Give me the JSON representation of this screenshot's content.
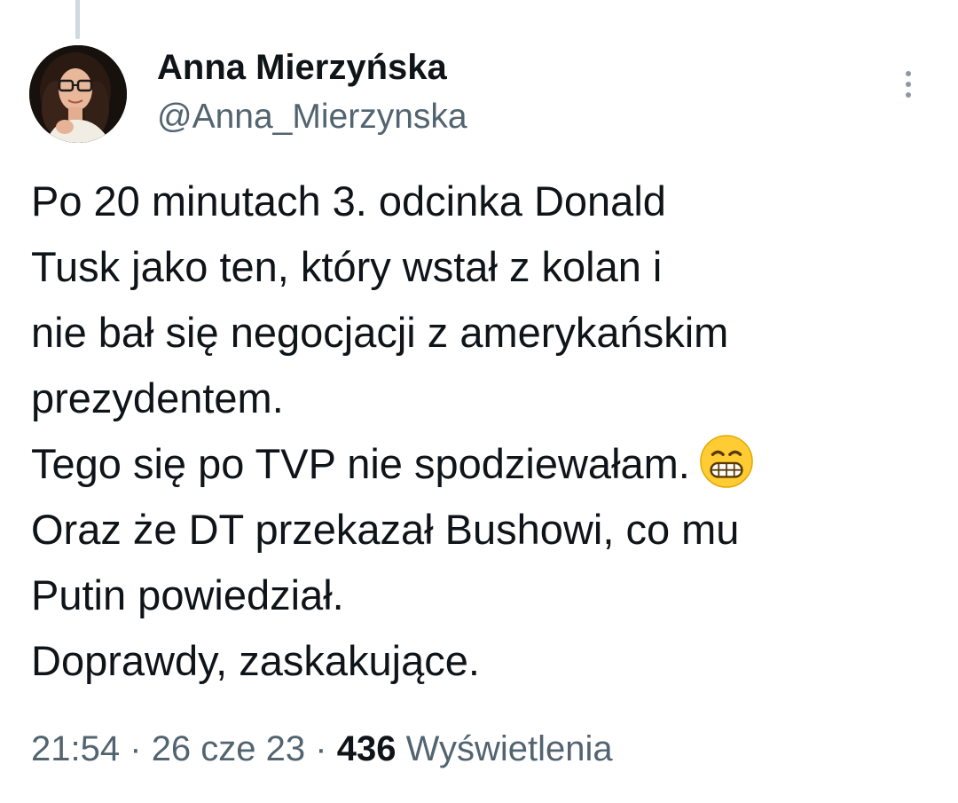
{
  "tweet": {
    "author": {
      "display_name": "Anna Mierzyńska",
      "handle": "@Anna_Mierzynska"
    },
    "text_lines": [
      "Po 20 minutach 3. odcinka Donald",
      "Tusk jako ten, który wstał z kolan i",
      "nie bał się negocjacji z amerykańskim",
      "prezydentem.",
      "Tego się po TVP nie spodziewałam.",
      "Oraz że DT przekazał Bushowi, co mu",
      "Putin powiedział.",
      "Doprawdy, zaskakujące."
    ],
    "emoji": "grinning-face-with-smiling-eyes",
    "meta": {
      "time": "21:54",
      "separator": "·",
      "date": "26 cze 23",
      "views_count": "436",
      "views_label": "Wyświetlenia"
    }
  },
  "icons": {
    "more": "vertical-ellipsis-icon",
    "avatar": "profile-photo"
  },
  "colors": {
    "text_primary": "#0f1419",
    "text_secondary": "#536471",
    "thread_line": "#cfd9de",
    "more_icon": "#8b98a5",
    "emoji_face": "#ffcc33"
  }
}
